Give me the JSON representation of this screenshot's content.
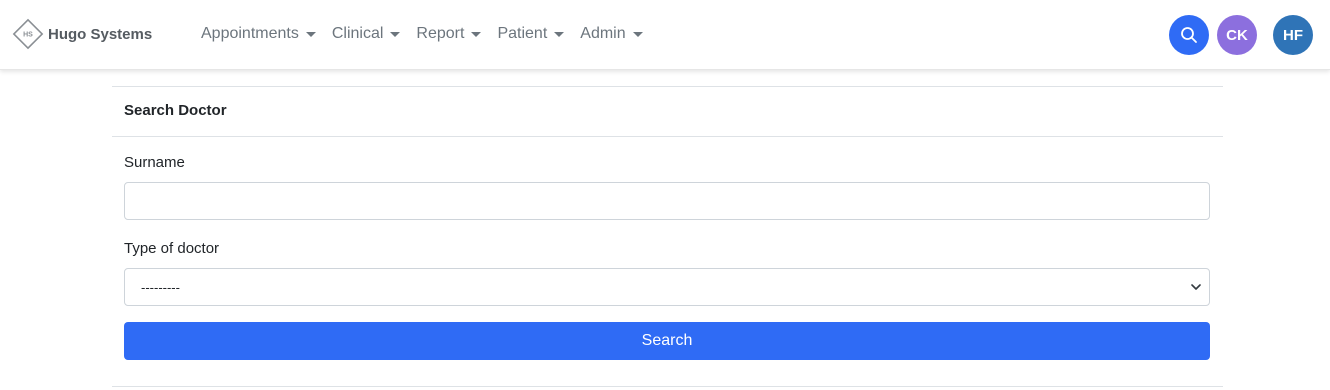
{
  "brand": {
    "name": "Hugo Systems",
    "logo_text": "HS"
  },
  "nav": {
    "items": [
      {
        "label": "Appointments"
      },
      {
        "label": "Clinical"
      },
      {
        "label": "Report"
      },
      {
        "label": "Patient"
      },
      {
        "label": "Admin"
      }
    ],
    "right": {
      "search_icon": "search-icon",
      "avatars": [
        {
          "initials": "CK",
          "color": "#8c6fde"
        },
        {
          "initials": "HF",
          "color": "#2f74b7"
        }
      ]
    }
  },
  "card": {
    "title": "Search Doctor",
    "fields": {
      "surname_label": "Surname",
      "surname_value": "",
      "type_label": "Type of doctor",
      "type_selected": "---------"
    },
    "submit_label": "Search"
  },
  "colors": {
    "primary": "#2f6bf5"
  }
}
